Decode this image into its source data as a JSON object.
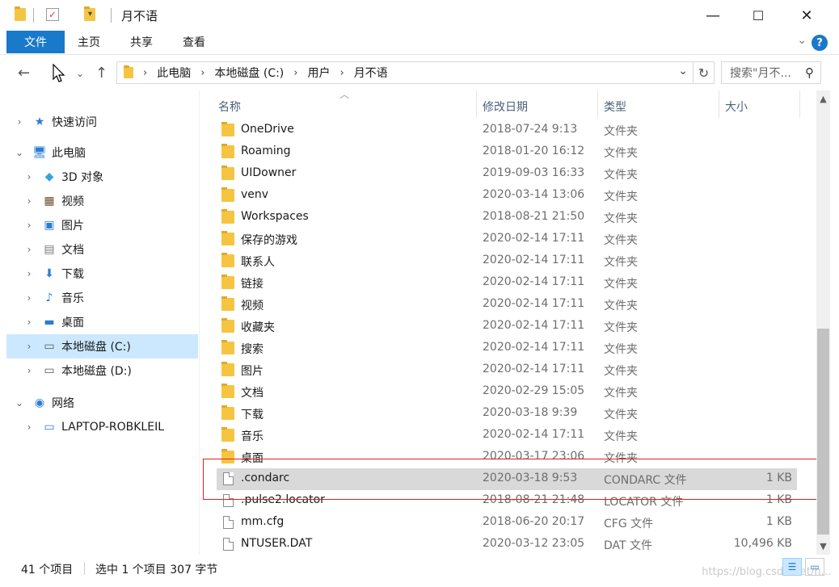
{
  "window": {
    "title": "月不语",
    "minimize": "—",
    "maximize": "☐",
    "close": "✕"
  },
  "ribbon": {
    "tabs": [
      "文件",
      "主页",
      "共享",
      "查看"
    ],
    "help": "?"
  },
  "nav": {
    "breadcrumb": [
      "此电脑",
      "本地磁盘 (C:)",
      "用户",
      "月不语"
    ],
    "search_placeholder": "搜索\"月不..."
  },
  "sidebar": {
    "items": [
      {
        "label": "快速访问",
        "icon": "star-icon",
        "level": 0,
        "expander": "›"
      },
      {
        "label": "此电脑",
        "icon": "computer-icon",
        "level": 0,
        "expander": "⌄"
      },
      {
        "label": "3D 对象",
        "icon": "3d-objects-icon",
        "level": 1,
        "expander": "›"
      },
      {
        "label": "视频",
        "icon": "video-icon",
        "level": 1,
        "expander": "›"
      },
      {
        "label": "图片",
        "icon": "pictures-icon",
        "level": 1,
        "expander": "›"
      },
      {
        "label": "文档",
        "icon": "documents-icon",
        "level": 1,
        "expander": "›"
      },
      {
        "label": "下载",
        "icon": "download-icon",
        "level": 1,
        "expander": "›"
      },
      {
        "label": "音乐",
        "icon": "music-icon",
        "level": 1,
        "expander": "›"
      },
      {
        "label": "桌面",
        "icon": "desktop-icon",
        "level": 1,
        "expander": "›"
      },
      {
        "label": "本地磁盘 (C:)",
        "icon": "drive-c-icon",
        "level": 1,
        "expander": "›",
        "selected": true
      },
      {
        "label": "本地磁盘 (D:)",
        "icon": "drive-d-icon",
        "level": 1,
        "expander": "›"
      },
      {
        "label": "网络",
        "icon": "network-icon",
        "level": 0,
        "expander": "⌄"
      },
      {
        "label": "LAPTOP-ROBKLEIL",
        "icon": "network-computer-icon",
        "level": 1,
        "expander": "›"
      }
    ]
  },
  "columns": {
    "name": "名称",
    "modified": "修改日期",
    "type": "类型",
    "size": "大小"
  },
  "files": [
    {
      "name": "OneDrive",
      "date": "2018-07-24 9:13",
      "type": "文件夹",
      "size": "",
      "kind": "folder"
    },
    {
      "name": "Roaming",
      "date": "2018-01-20 16:12",
      "type": "文件夹",
      "size": "",
      "kind": "folder"
    },
    {
      "name": "UIDowner",
      "date": "2019-09-03 16:33",
      "type": "文件夹",
      "size": "",
      "kind": "folder"
    },
    {
      "name": "venv",
      "date": "2020-03-14 13:06",
      "type": "文件夹",
      "size": "",
      "kind": "folder"
    },
    {
      "name": "Workspaces",
      "date": "2018-08-21 21:50",
      "type": "文件夹",
      "size": "",
      "kind": "folder"
    },
    {
      "name": "保存的游戏",
      "date": "2020-02-14 17:11",
      "type": "文件夹",
      "size": "",
      "kind": "folder"
    },
    {
      "name": "联系人",
      "date": "2020-02-14 17:11",
      "type": "文件夹",
      "size": "",
      "kind": "folder"
    },
    {
      "name": "链接",
      "date": "2020-02-14 17:11",
      "type": "文件夹",
      "size": "",
      "kind": "folder"
    },
    {
      "name": "视频",
      "date": "2020-02-14 17:11",
      "type": "文件夹",
      "size": "",
      "kind": "folder"
    },
    {
      "name": "收藏夹",
      "date": "2020-02-14 17:11",
      "type": "文件夹",
      "size": "",
      "kind": "folder"
    },
    {
      "name": "搜索",
      "date": "2020-02-14 17:11",
      "type": "文件夹",
      "size": "",
      "kind": "folder"
    },
    {
      "name": "图片",
      "date": "2020-02-14 17:11",
      "type": "文件夹",
      "size": "",
      "kind": "folder"
    },
    {
      "name": "文档",
      "date": "2020-02-29 15:05",
      "type": "文件夹",
      "size": "",
      "kind": "folder"
    },
    {
      "name": "下载",
      "date": "2020-03-18 9:39",
      "type": "文件夹",
      "size": "",
      "kind": "folder"
    },
    {
      "name": "音乐",
      "date": "2020-02-14 17:11",
      "type": "文件夹",
      "size": "",
      "kind": "folder"
    },
    {
      "name": "桌面",
      "date": "2020-03-17 23:06",
      "type": "文件夹",
      "size": "",
      "kind": "folder"
    },
    {
      "name": ".condarc",
      "date": "2020-03-18 9:53",
      "type": "CONDARC 文件",
      "size": "1 KB",
      "kind": "file",
      "selected": true
    },
    {
      "name": ".pulse2.locator",
      "date": "2018-08-21 21:48",
      "type": "LOCATOR 文件",
      "size": "1 KB",
      "kind": "file"
    },
    {
      "name": "mm.cfg",
      "date": "2018-06-20 20:17",
      "type": "CFG 文件",
      "size": "1 KB",
      "kind": "file"
    },
    {
      "name": "NTUSER.DAT",
      "date": "2020-03-12 23:05",
      "type": "DAT 文件",
      "size": "10,496 KB",
      "kind": "file"
    }
  ],
  "status": {
    "count": "41 个项目",
    "selection": "选中 1 个项目  307 字节"
  },
  "watermark": "https://blog.csdn.net/h..."
}
